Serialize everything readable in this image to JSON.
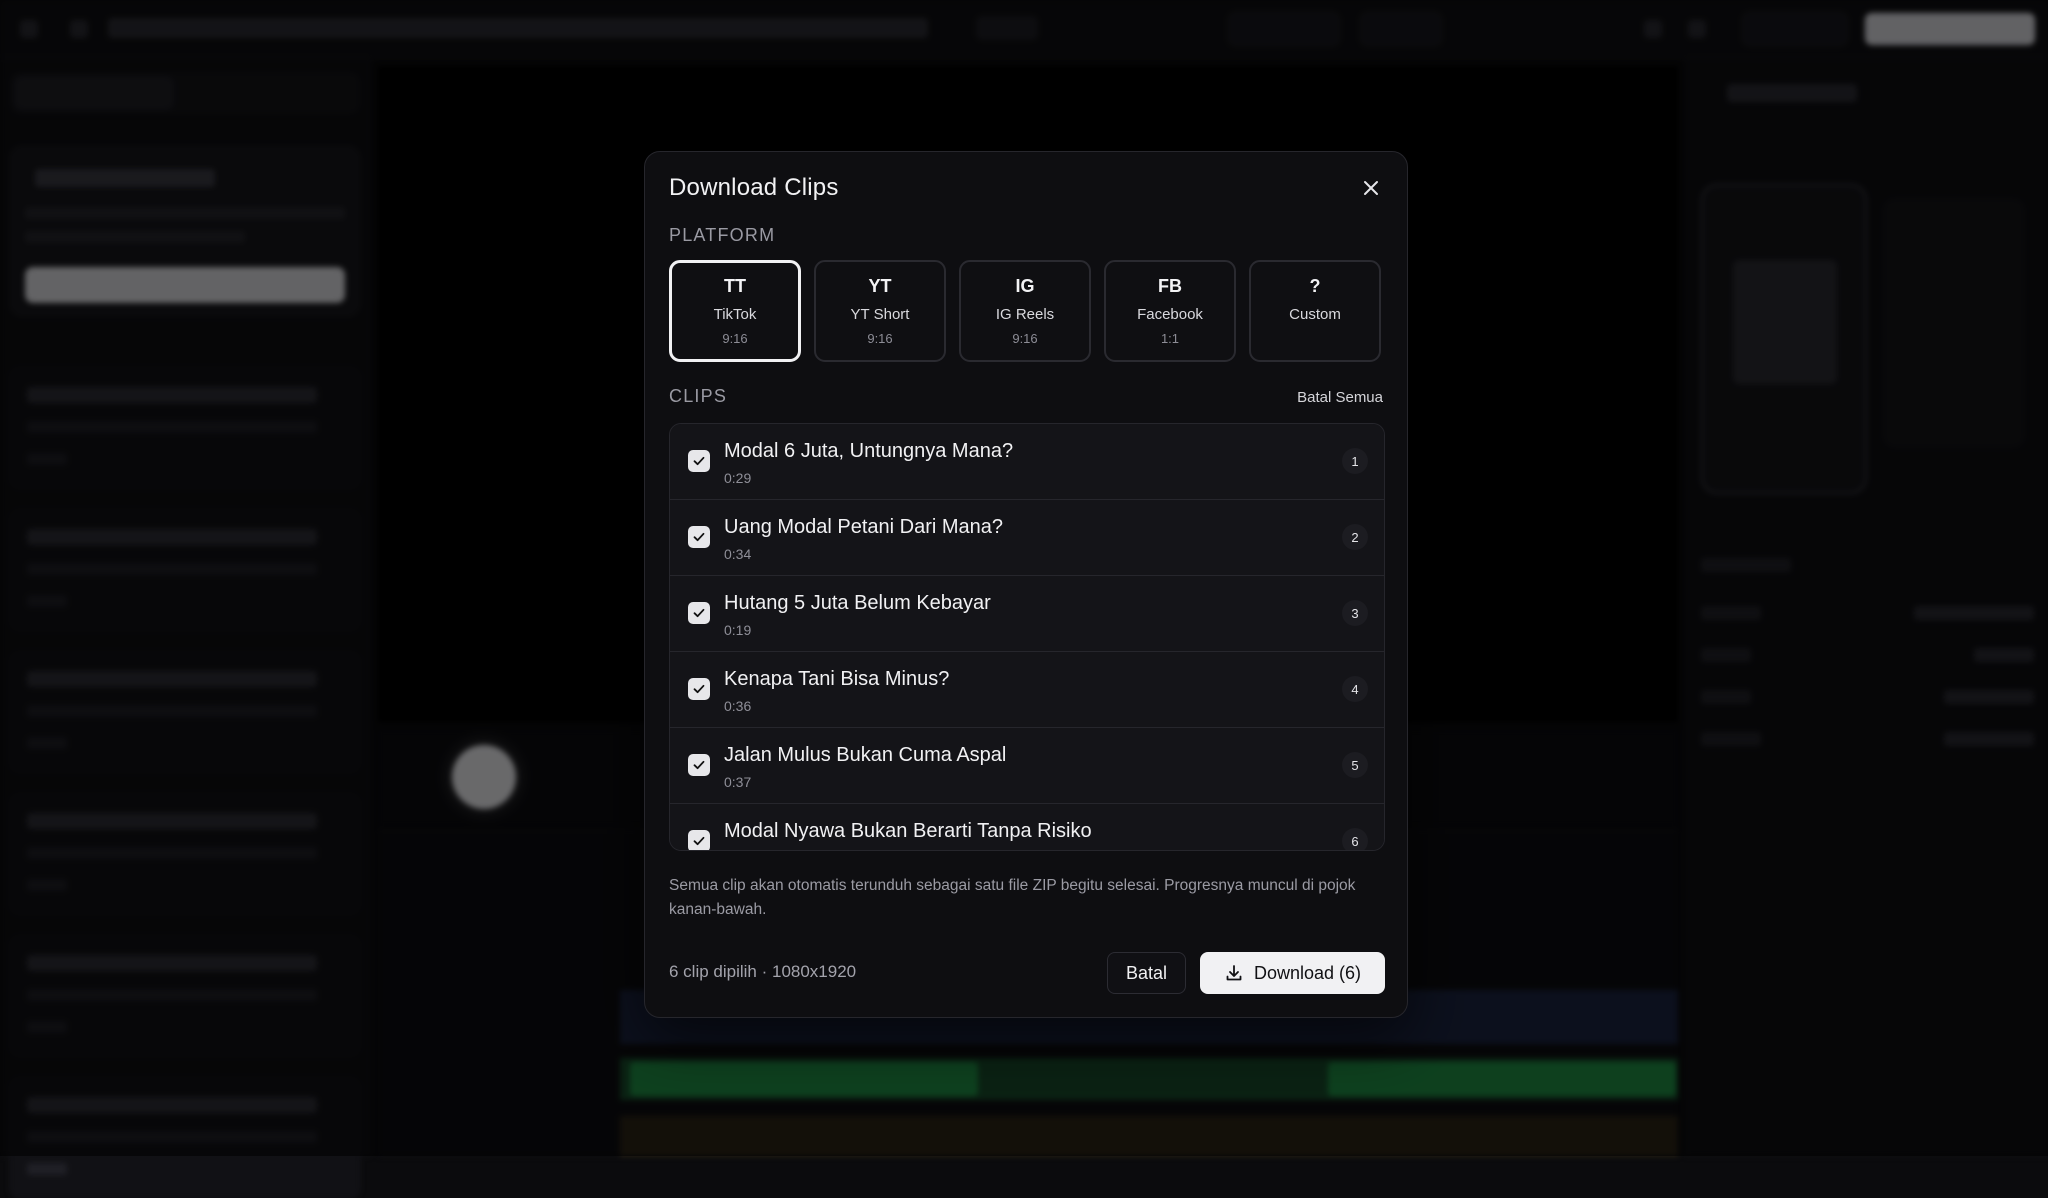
{
  "modal": {
    "title": "Download Clips",
    "platform_label": "PLATFORM",
    "clips_label": "CLIPS",
    "deselect_all": "Batal Semua",
    "note": "Semua clip akan otomatis terunduh sebagai satu file ZIP begitu selesai. Progresnya muncul di pojok kanan-bawah.",
    "selection_info": "6 clip dipilih · 1080x1920",
    "cancel_label": "Batal",
    "download_label": "Download (6)"
  },
  "platforms": [
    {
      "code": "TT",
      "name": "TikTok",
      "ratio": "9:16",
      "selected": true
    },
    {
      "code": "YT",
      "name": "YT Short",
      "ratio": "9:16",
      "selected": false
    },
    {
      "code": "IG",
      "name": "IG Reels",
      "ratio": "9:16",
      "selected": false
    },
    {
      "code": "FB",
      "name": "Facebook",
      "ratio": "1:1",
      "selected": false
    },
    {
      "code": "?",
      "name": "Custom",
      "ratio": "",
      "selected": false
    }
  ],
  "clips": [
    {
      "title": "Modal 6 Juta, Untungnya Mana?",
      "duration": "0:29",
      "number": "1",
      "checked": true
    },
    {
      "title": "Uang Modal Petani Dari Mana?",
      "duration": "0:34",
      "number": "2",
      "checked": true
    },
    {
      "title": "Hutang 5 Juta Belum Kebayar",
      "duration": "0:19",
      "number": "3",
      "checked": true
    },
    {
      "title": "Kenapa Tani Bisa Minus?",
      "duration": "0:36",
      "number": "4",
      "checked": true
    },
    {
      "title": "Jalan Mulus Bukan Cuma Aspal",
      "duration": "0:37",
      "number": "5",
      "checked": true
    },
    {
      "title": "Modal Nyawa Bukan Berarti Tanpa Risiko",
      "duration": "",
      "number": "6",
      "checked": true
    }
  ],
  "icons": {
    "close": "close-icon",
    "check": "check-icon",
    "download": "download-icon"
  },
  "colors": {
    "modal_bg": "#0e0e11",
    "accent": "#f1f1f3",
    "border": "#26262c",
    "green_track": "#1f8f44",
    "blue_track": "#1b2440"
  }
}
